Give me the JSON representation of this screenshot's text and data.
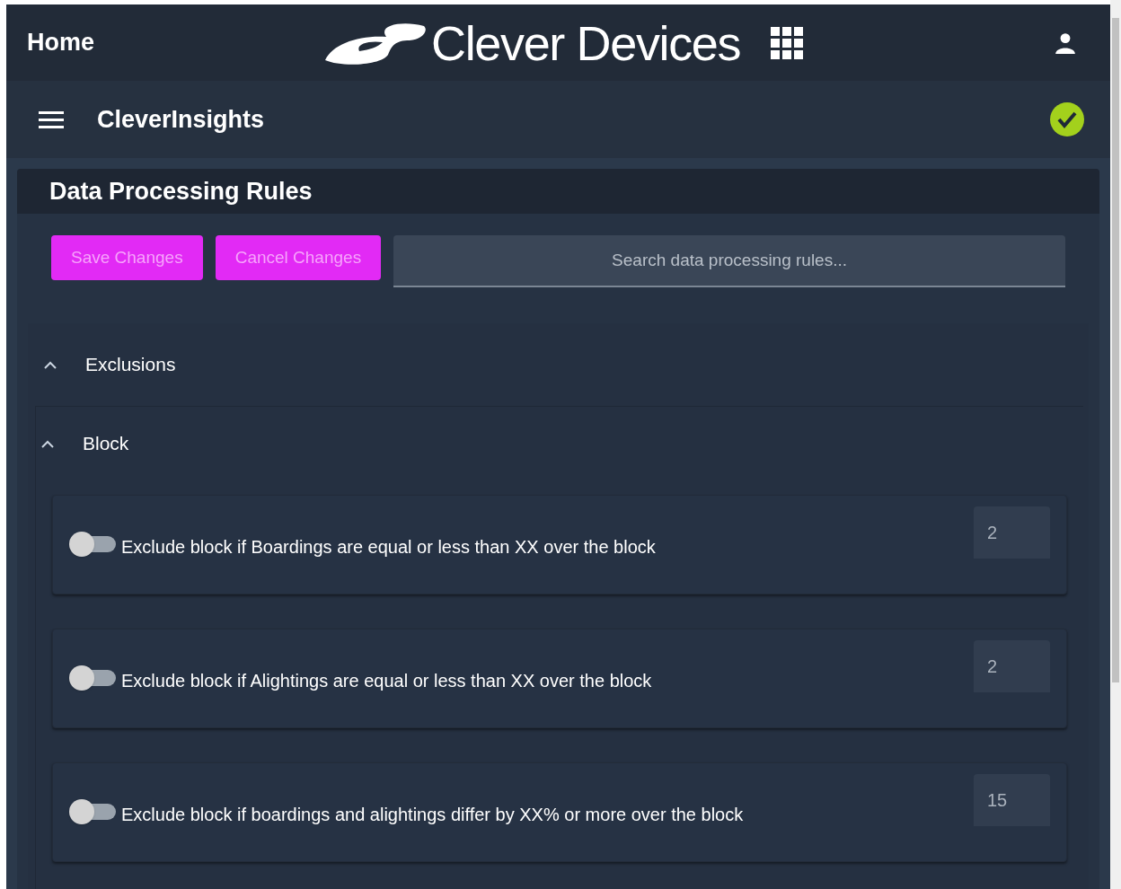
{
  "top_bar": {
    "home": "Home",
    "brand": "Clever Devices"
  },
  "app_bar": {
    "title": "CleverInsights",
    "status_ok": true
  },
  "card": {
    "title": "Data Processing Rules",
    "buttons": [
      {
        "label": "Save Changes",
        "disabled": true
      },
      {
        "label": "Cancel Changes",
        "disabled": true
      }
    ],
    "search": {
      "placeholder": "Search data processing rules..."
    },
    "section": {
      "title": "Exclusions",
      "expanded": true,
      "group": {
        "title": "Block",
        "expanded": true,
        "rules": [
          {
            "label": "Exclude block if Boardings are equal or less than XX over the block",
            "on": false,
            "value": "2"
          },
          {
            "label": "Exclude block if Alightings are equal or less than XX over the block",
            "on": false,
            "value": "2"
          },
          {
            "label": "Exclude block if boardings and alightings differ by XX% or more over the block",
            "on": false,
            "value": "15"
          }
        ]
      }
    }
  }
}
